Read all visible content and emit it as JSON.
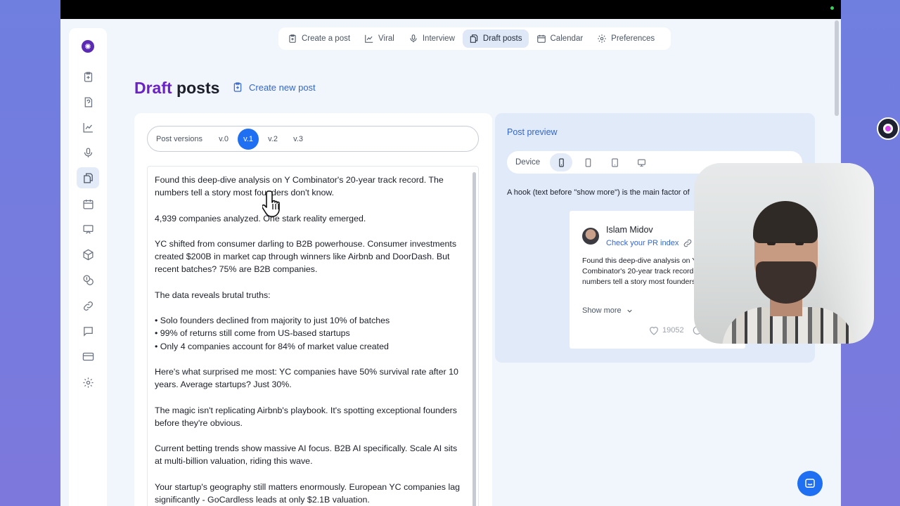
{
  "nav": {
    "items": [
      {
        "label": "Create a post",
        "icon": "clipboard-plus-icon"
      },
      {
        "label": "Viral",
        "icon": "chart-line-icon"
      },
      {
        "label": "Interview",
        "icon": "microphone-icon"
      },
      {
        "label": "Draft posts",
        "icon": "documents-icon",
        "active": true
      },
      {
        "label": "Calendar",
        "icon": "calendar-icon"
      },
      {
        "label": "Preferences",
        "icon": "gear-icon"
      }
    ]
  },
  "page": {
    "title_accent": "Draft",
    "title_rest": " posts",
    "create_new_label": "Create new post"
  },
  "versions": {
    "label": "Post versions",
    "items": [
      "v.0",
      "v.1",
      "v.2",
      "v.3"
    ],
    "active": "v.1"
  },
  "draft": {
    "paragraphs": [
      "Found this deep-dive analysis on Y Combinator's 20-year track record. The numbers tell a story most founders don't know.",
      "4,939 companies analyzed. One stark reality emerged.",
      "YC shifted from consumer darling to B2B powerhouse. Consumer investments created $200B in market cap through winners like Airbnb and DoorDash. But recent batches? 75% are B2B companies.",
      "The data reveals brutal truths:",
      "• Solo founders declined from majority to just 10% of batches\n• 99% of returns still come from US-based startups\n• Only 4 companies account for 84% of market value created",
      "Here's what surprised me most: YC companies have 50% survival rate after 10 years. Average startups? Just 30%.",
      "The magic isn't replicating Airbnb's playbook. It's spotting exceptional founders before they're obvious.",
      "Current betting trends show massive AI focus. B2B AI specifically. Scale AI sits at multi-billion valuation, riding this wave.",
      "Your startup's geography still matters enormously. European YC companies lag significantly - GoCardless leads at only $2.1B valuation."
    ]
  },
  "preview": {
    "title": "Post preview",
    "device_label": "Device",
    "hook_hint": "A hook (text before \"show more\") is the main factor of",
    "author_name": "Islam Midov",
    "author_sub": "Check your PR index",
    "post_text": "Found this deep-dive analysis on Y Combinator's 20-year track record. The numbers tell a story most founders don't know.",
    "show_more": "Show more",
    "likes": "19052",
    "comments": "1("
  },
  "colors": {
    "accent_purple": "#6b21c8",
    "link_blue": "#3366cc",
    "primary_blue": "#1f6ff2"
  }
}
